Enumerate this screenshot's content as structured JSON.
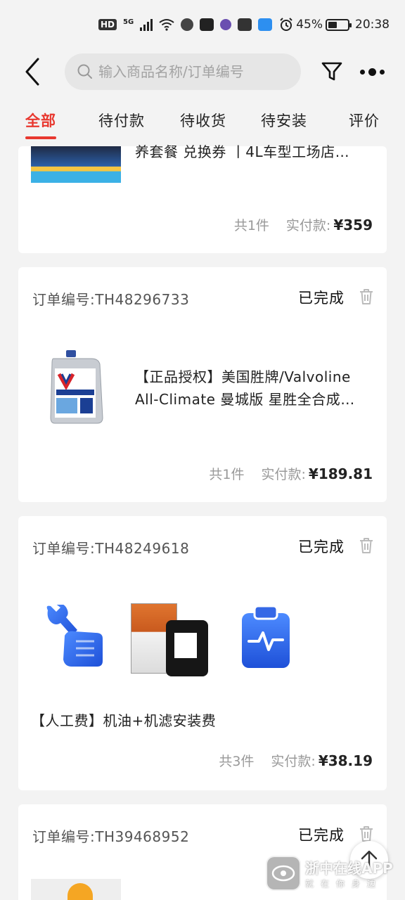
{
  "status_bar": {
    "network": "5G",
    "battery": "45%",
    "time": "20:38",
    "battery_fraction": 0.45
  },
  "search": {
    "placeholder": "输入商品名称/订单编号"
  },
  "tabs": [
    "全部",
    "待付款",
    "待收货",
    "待安装",
    "评价"
  ],
  "active_tab": 0,
  "orders": [
    {
      "title": "养套餐 兑换券 丨4L车型工场店…",
      "count": "共1件",
      "paid_label": "实付款:",
      "price": "¥359"
    },
    {
      "order_label": "订单编号:",
      "order_no": "TH48296733",
      "status": "已完成",
      "title_line1": "【正品授权】美国胜牌/Valvoline",
      "title_line2": "All-Climate 曼城版 星胜全合成…",
      "count": "共1件",
      "paid_label": "实付款:",
      "price": "¥189.81"
    },
    {
      "order_label": "订单编号:",
      "order_no": "TH48249618",
      "status": "已完成",
      "title": "【人工费】机油+机滤安装费",
      "count": "共3件",
      "paid_label": "实付款:",
      "price": "¥38.19"
    },
    {
      "order_label": "订单编号:",
      "order_no": "TH39468952",
      "status": "已完成"
    }
  ],
  "watermark": {
    "line1": "浙中在线APP",
    "line2": "就在你身边"
  },
  "colors": {
    "accent": "#e8382f",
    "background": "#f3f3f3",
    "icon_blue": "#2f6fe6"
  }
}
